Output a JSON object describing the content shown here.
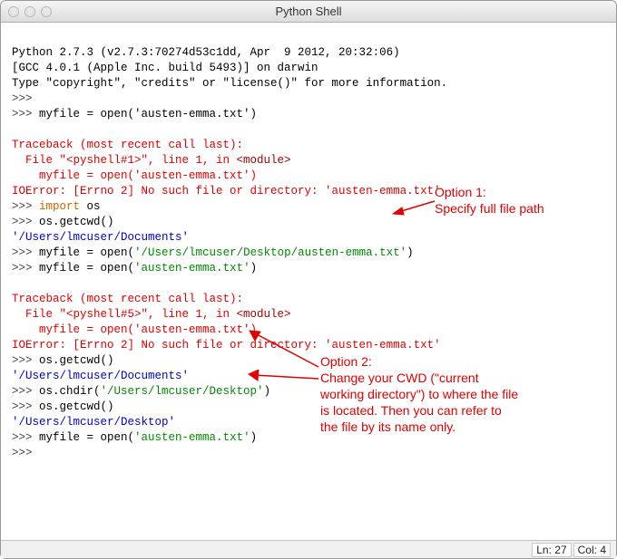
{
  "window": {
    "title": "Python Shell"
  },
  "banner": {
    "line1": "Python 2.7.3 (v2.7.3:70274d53c1dd, Apr  9 2012, 20:32:06)",
    "line2": "[GCC 4.0.1 (Apple Inc. build 5493)] on darwin",
    "line3": "Type \"copyright\", \"credits\" or \"license()\" for more information."
  },
  "prompt": ">>> ",
  "cont": "    ",
  "lines": {
    "l1": "myfile = open('austen-emma.txt')",
    "tb_header": "Traceback (most recent call last):",
    "tb_file1_a": "  File \"<pyshell#1>\", line 1, in ",
    "tb_file1_mod": "<module>",
    "tb_file5_a": "  File \"<pyshell#5>\", line 1, in ",
    "tb_src": "    myfile = open('austen-emma.txt')",
    "tb_err": "IOError: [Errno 2] No such file or directory: 'austen-emma.txt'",
    "import_kw": "import",
    "import_mod": " os",
    "getcwd": "os.getcwd()",
    "cwd_docs": "'/Users/lmcuser/Documents'",
    "open_full_a": "myfile = open(",
    "open_full_b": "'/Users/lmcuser/Desktop/austen-emma.txt'",
    "open_full_c": ")",
    "open_short_a": "myfile = open(",
    "open_short_b": "'austen-emma.txt'",
    "open_short_c": ")",
    "chdir_a": "os.chdir(",
    "chdir_b": "'/Users/lmcuser/Desktop'",
    "chdir_c": ")",
    "cwd_desk": "'/Users/lmcuser/Desktop'"
  },
  "annotations": {
    "opt1_title": "Option 1:",
    "opt1_text": "Specify full file path",
    "opt2_title": "Option 2:",
    "opt2_text1": "Change your CWD (\"current",
    "opt2_text2": "working directory\") to where the file",
    "opt2_text3": "is located. Then you can refer to",
    "opt2_text4": "the file by its name only."
  },
  "status": {
    "ln_label": "Ln: ",
    "ln": "27",
    "col_label": "Col: ",
    "col": "4"
  }
}
